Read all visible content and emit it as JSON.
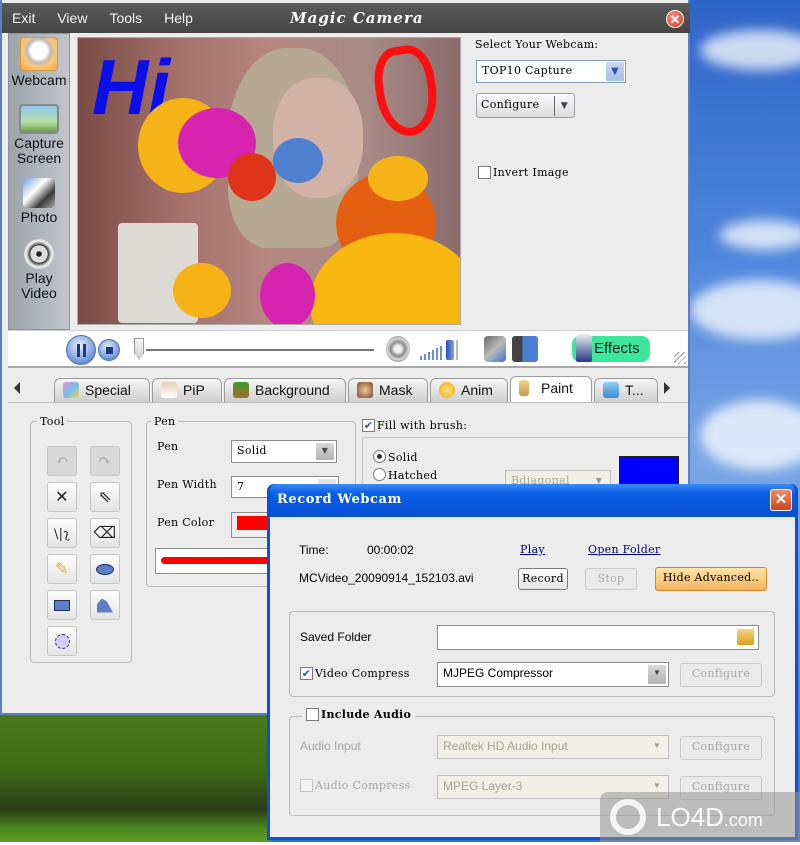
{
  "main_window": {
    "title": "Magic Camera",
    "menu": [
      "Exit",
      "View",
      "Tools",
      "Help"
    ],
    "sidebar": [
      {
        "label": "Webcam",
        "icon": "webcam-icon"
      },
      {
        "label": "Capture Screen",
        "icon": "monitor-icon"
      },
      {
        "label": "Photo",
        "icon": "photo-icon"
      },
      {
        "label": "Play Video",
        "icon": "film-reel-icon"
      }
    ],
    "video_overlay_text": "Hi",
    "webcam": {
      "select_label": "Select Your Webcam:",
      "selected": "TOP10 Capture",
      "configure_label": "Configure",
      "invert_label": "Invert Image",
      "invert_checked": false
    },
    "controls": {
      "effects_label": "Effects",
      "seek_position": 0
    },
    "tabs": [
      "Special",
      "PiP",
      "Background",
      "Mask",
      "Anim",
      "Paint",
      "T..."
    ],
    "active_tab": "Paint",
    "paint": {
      "tool_group_title": "Tool",
      "pen_group_title": "Pen",
      "pen_label": "Pen",
      "pen_style": "Solid",
      "pen_width_label": "Pen Width",
      "pen_width": "7",
      "pen_color_label": "Pen Color",
      "pen_color": "#ff0000",
      "fill_label": "Fill with brush:",
      "fill_checked": true,
      "brush_solid_label": "Solid",
      "brush_hatched_label": "Hatched",
      "brush_selected": "Solid",
      "hatch_style": "Bdiagonal",
      "brush_color": "#0000ff",
      "tools": [
        "undo",
        "redo",
        "delete",
        "select",
        "line",
        "eraser",
        "pencil",
        "ellipse",
        "rectangle",
        "polygon",
        "circle-select"
      ]
    }
  },
  "record_dialog": {
    "title": "Record Webcam",
    "time_label": "Time:",
    "time_value": "00:00:02",
    "filename": "MCVideo_20090914_152103.avi",
    "play_link": "Play",
    "open_folder_link": "Open Folder",
    "record_button": "Record",
    "stop_button": "Stop",
    "hide_advanced_button": "Hide Advanced..",
    "saved_folder_label": "Saved Folder",
    "saved_folder_value": "",
    "video_compress_label": "Video Compress",
    "video_compress_checked": true,
    "video_compressor": "MJPEG Compressor",
    "configure_label": "Configure",
    "include_audio_label": "Include Audio",
    "include_audio_checked": false,
    "audio_input_label": "Audio Input",
    "audio_input_value": "Realtek HD Audio Input",
    "audio_compress_label": "Audio Compress",
    "audio_compress_checked": false,
    "audio_compressor": "MPEG Layer-3"
  },
  "watermark": {
    "text": "LO4D",
    "suffix": ".com"
  }
}
